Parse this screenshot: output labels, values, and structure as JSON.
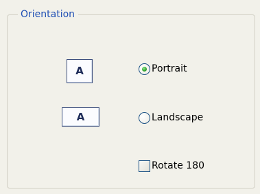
{
  "group": {
    "title": "Orientation"
  },
  "previews": {
    "portrait_glyph": "A",
    "landscape_glyph": "A"
  },
  "options": {
    "portrait": {
      "label": "Portrait",
      "checked": true
    },
    "landscape": {
      "label": "Landscape",
      "checked": false
    },
    "rotate": {
      "label": "Rotate 180",
      "checked": false
    }
  },
  "colors": {
    "group_title": "#1f4fb4",
    "radio_selected": "#34a632",
    "control_border": "#1d5386"
  }
}
